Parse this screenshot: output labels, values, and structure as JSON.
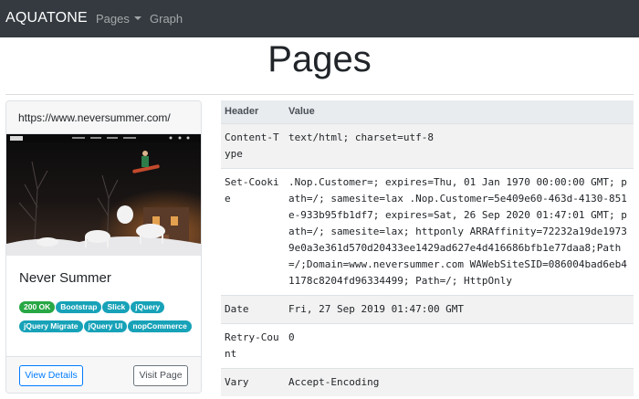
{
  "navbar": {
    "brand": "AQUATONE",
    "pages_label": "Pages",
    "graph_label": "Graph"
  },
  "page": {
    "title": "Pages"
  },
  "card": {
    "url": "https://www.neversummer.com/",
    "title": "Never Summer",
    "badges": [
      "200 OK",
      "Bootstrap",
      "Slick",
      "jQuery",
      "jQuery Migrate",
      "jQuery UI",
      "nopCommerce"
    ],
    "view_details_label": "View Details",
    "visit_page_label": "Visit Page"
  },
  "headers_table": {
    "columns": [
      "Header",
      "Value"
    ],
    "rows": [
      {
        "header": "Content-Type",
        "value": "text/html; charset=utf-8"
      },
      {
        "header": "Set-Cookie",
        "value": ".Nop.Customer=; expires=Thu, 01 Jan 1970 00:00:00 GMT; path=/; samesite=lax .Nop.Customer=5e409e60-463d-4130-851e-933b95fb1df7; expires=Sat, 26 Sep 2020 01:47:01 GMT; path=/; samesite=lax; httponly ARRAffinity=72232a19de19739e0a3e361d570d20433ee1429ad627e4d416686bfb1e77daa8;Path=/;Domain=www.neversummer.com WAWebSiteSID=086004bad6eb41178c8204fd96334499; Path=/; HttpOnly"
      },
      {
        "header": "Date",
        "value": "Fri, 27 Sep 2019 01:47:00 GMT"
      },
      {
        "header": "Retry-Count",
        "value": "0"
      },
      {
        "header": "Vary",
        "value": "Accept-Encoding"
      }
    ]
  },
  "colors": {
    "navbar": "#343a40",
    "badge_success": "#28a745",
    "badge_info": "#17a2b8",
    "primary": "#007bff"
  }
}
